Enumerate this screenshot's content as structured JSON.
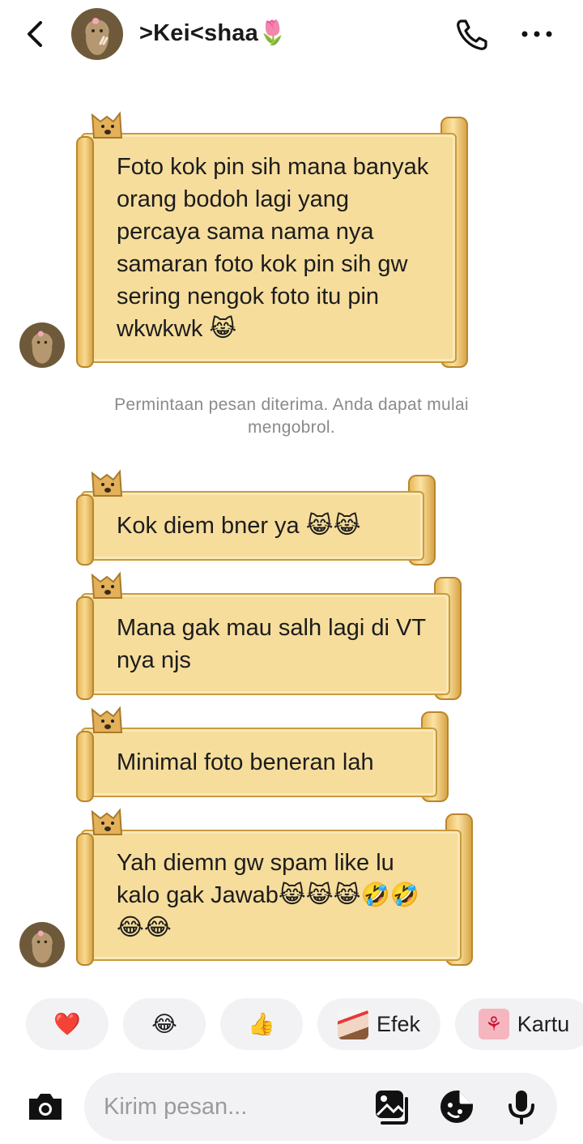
{
  "header": {
    "contact_name": ">Kei<shaa🌷"
  },
  "messages": [
    {
      "text": "Foto kok pin sih mana banyak orang bodoh lagi yang percaya sama nama nya samaran foto kok pin sih gw sering nengok foto itu pin wkwkwk 😹"
    },
    {
      "text": "Kok diem bner ya 😹😹"
    },
    {
      "text": "Mana gak mau salh lagi di VT nya njs"
    },
    {
      "text": "Minimal foto beneran lah"
    },
    {
      "text": "Yah diemn gw spam like lu kalo gak Jawab😹😹😹🤣🤣😂😂"
    }
  ],
  "system_note": "Permintaan pesan diterima. Anda dapat mulai mengobrol.",
  "quick_reactions": [
    {
      "emoji": "❤️"
    },
    {
      "emoji": "😂"
    },
    {
      "emoji": "👍"
    }
  ],
  "chips": {
    "effect_label": "Efek",
    "card_label": "Kartu"
  },
  "input": {
    "placeholder": "Kirim pesan..."
  },
  "icons": {
    "back": "chevron-left-icon",
    "call": "phone-icon",
    "more": "more-horizontal-icon",
    "camera": "camera-icon",
    "gallery": "image-icon",
    "sticker": "sticker-icon",
    "mic": "microphone-icon"
  },
  "colors": {
    "scroll_fill": "#f6dd9c",
    "scroll_border": "#c99a3e",
    "chip_bg": "#f2f2f4"
  }
}
